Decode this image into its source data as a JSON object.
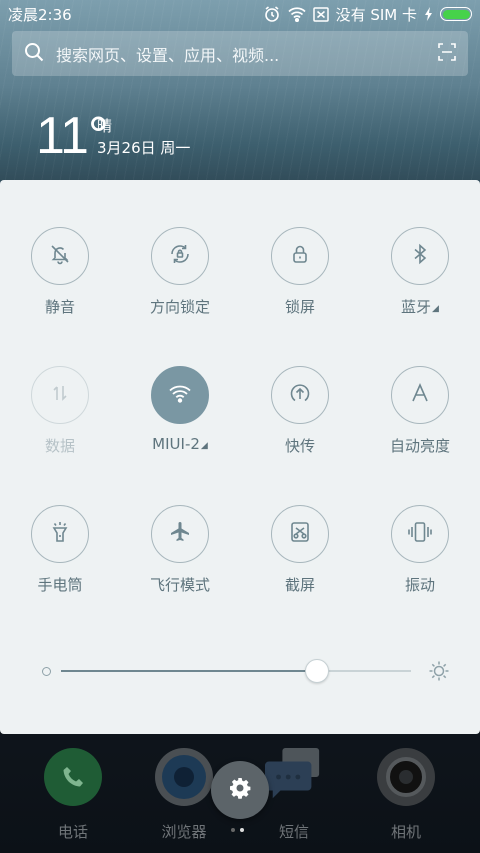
{
  "status_bar": {
    "time": "凌晨2:36",
    "carrier": "没有 SIM 卡",
    "battery_level": 1.0,
    "icons": [
      "alarm-icon",
      "wifi-icon",
      "sim-icon",
      "charging-icon",
      "battery-icon"
    ]
  },
  "search": {
    "placeholder": "搜索网页、设置、应用、视频...",
    "icons": [
      "search-icon",
      "scan-icon"
    ]
  },
  "weather": {
    "temperature": "11°",
    "condition": "晴",
    "date": "3月26日 周一"
  },
  "toggles": [
    {
      "id": "mute",
      "label": "静音",
      "icon": "bell-off-icon",
      "state": "off"
    },
    {
      "id": "rotation",
      "label": "方向锁定",
      "icon": "rotation-lock-icon",
      "state": "off"
    },
    {
      "id": "lock",
      "label": "锁屏",
      "icon": "lock-icon",
      "state": "off"
    },
    {
      "id": "bluetooth",
      "label": "蓝牙",
      "icon": "bluetooth-icon",
      "state": "off",
      "expandable": true
    },
    {
      "id": "data",
      "label": "数据",
      "icon": "mobile-data-icon",
      "state": "disabled"
    },
    {
      "id": "wifi",
      "label": "MIUI-2",
      "icon": "wifi-icon",
      "state": "on",
      "expandable": true
    },
    {
      "id": "share",
      "label": "快传",
      "icon": "quick-transfer-icon",
      "state": "off"
    },
    {
      "id": "auto_brightness",
      "label": "自动亮度",
      "icon": "letter-a-icon",
      "state": "off"
    },
    {
      "id": "flashlight",
      "label": "手电筒",
      "icon": "flashlight-icon",
      "state": "off"
    },
    {
      "id": "airplane",
      "label": "飞行模式",
      "icon": "airplane-icon",
      "state": "off"
    },
    {
      "id": "screenshot",
      "label": "截屏",
      "icon": "screenshot-icon",
      "state": "off"
    },
    {
      "id": "vibrate",
      "label": "振动",
      "icon": "vibrate-icon",
      "state": "off"
    }
  ],
  "brightness": {
    "level": 0.73
  },
  "dock": [
    {
      "label": "电话",
      "icon": "phone-icon",
      "color": "#1f5c35"
    },
    {
      "label": "浏览器",
      "icon": "browser-icon",
      "color": "#1d3a55"
    },
    {
      "label": "短信",
      "icon": "message-icon",
      "color": "#2c3f55"
    },
    {
      "label": "相机",
      "icon": "camera-icon",
      "color": "#3a3d40"
    }
  ],
  "colors": {
    "panel_bg": "#eef2f3",
    "accent": "#7a97a3",
    "icon_color": "#6f8790",
    "battery": "#46d24a"
  }
}
